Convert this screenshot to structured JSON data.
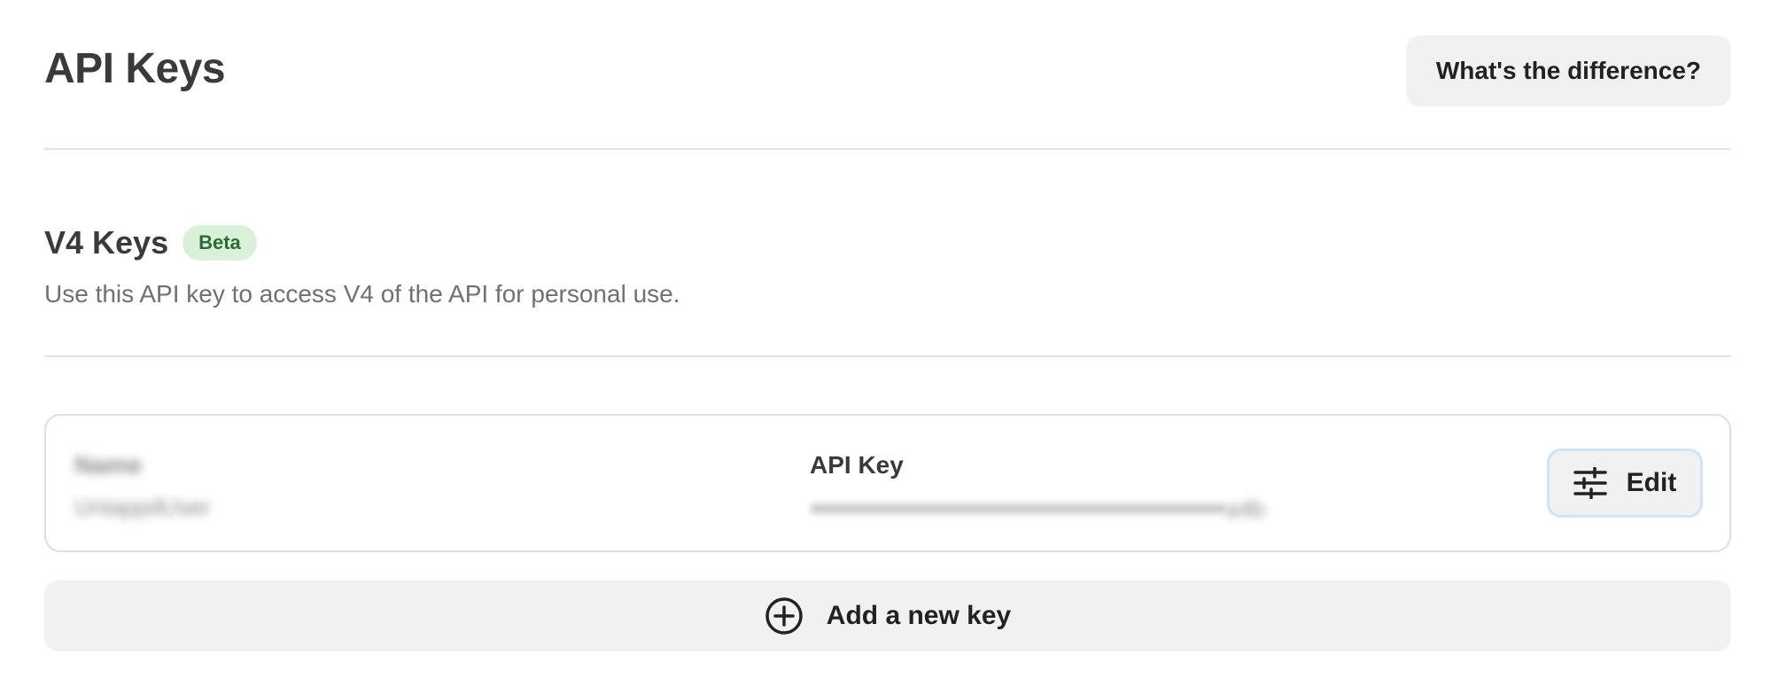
{
  "header": {
    "title": "API Keys",
    "help_button_label": "What's the difference?"
  },
  "section": {
    "title": "V4 Keys",
    "badge": "Beta",
    "description": "Use this API key to access V4 of the API for personal use."
  },
  "key_card": {
    "name_label": "Name",
    "name_value": "UntappdUser",
    "api_key_label": "API Key",
    "api_key_suffix": "a4b",
    "edit_label": "Edit",
    "edit_icon": "sliders-icon"
  },
  "add_button": {
    "label": "Add a new key",
    "icon": "plus-circle-icon"
  },
  "colors": {
    "badge_bg": "#d8f1d8",
    "badge_text": "#2f6b34",
    "button_bg": "#f1f1f1",
    "edit_focus_border": "#cfe4f8"
  }
}
